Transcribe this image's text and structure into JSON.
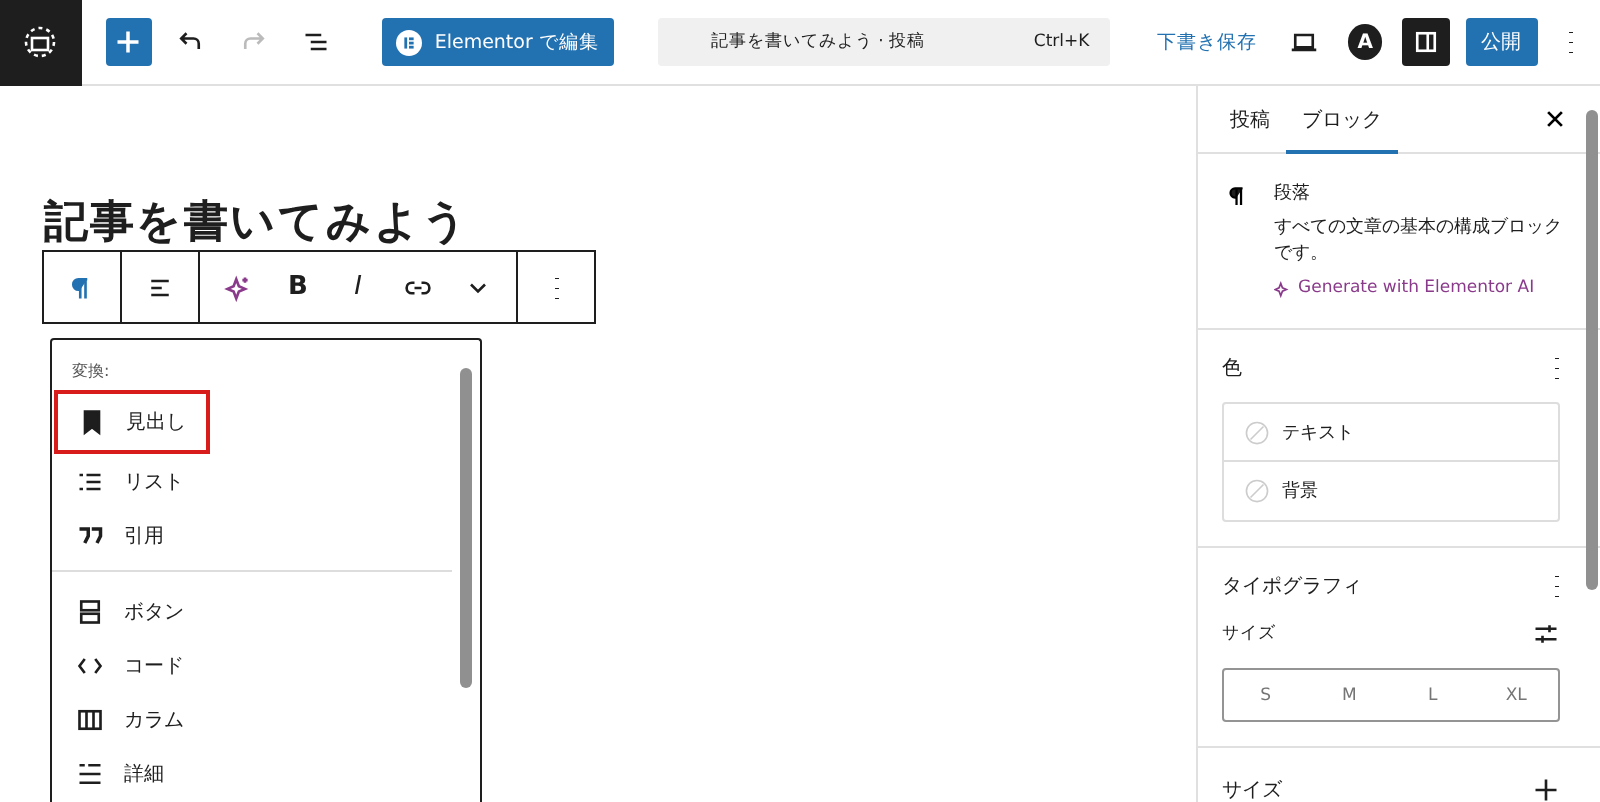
{
  "topbar": {
    "elementor_button": "Elementor で編集",
    "command": {
      "title": "記事を書いてみよう · 投稿",
      "shortcut": "Ctrl+K"
    },
    "save_draft": "下書き保存",
    "avatar_letter": "A",
    "sidebar_toggle": {
      "on": true
    },
    "publish": "公開"
  },
  "editor": {
    "title": "記事を書いてみよう",
    "toolbar": {
      "bold": "B",
      "italic": "I"
    },
    "transform_menu": {
      "heading": "変換:",
      "groups": [
        [
          {
            "kind": "bookmark",
            "label": "見出し",
            "highlighted": true
          },
          {
            "kind": "list",
            "label": "リスト",
            "highlighted": false
          },
          {
            "kind": "quote",
            "label": "引用",
            "highlighted": false
          }
        ],
        [
          {
            "kind": "button",
            "label": "ボタン",
            "highlighted": false
          },
          {
            "kind": "code",
            "label": "コード",
            "highlighted": false
          },
          {
            "kind": "columns",
            "label": "カラム",
            "highlighted": false
          },
          {
            "kind": "details",
            "label": "詳細",
            "highlighted": false
          }
        ]
      ]
    }
  },
  "sidebar": {
    "tabs": [
      {
        "label": "投稿",
        "selected": false
      },
      {
        "label": "ブロック",
        "selected": true
      }
    ],
    "block": {
      "name": "段落",
      "description": "すべての文章の基本の構成ブロックです。",
      "ai_link": "Generate with Elementor AI"
    },
    "color": {
      "title": "色",
      "items": [
        "テキスト",
        "背景"
      ]
    },
    "typography": {
      "title": "タイポグラフィ",
      "size_label": "サイズ",
      "sizes": [
        {
          "label": "S",
          "selected": false
        },
        {
          "label": "M",
          "selected": false
        },
        {
          "label": "L",
          "selected": false
        },
        {
          "label": "XL",
          "selected": false
        }
      ]
    },
    "size_section": {
      "title": "サイズ"
    }
  }
}
